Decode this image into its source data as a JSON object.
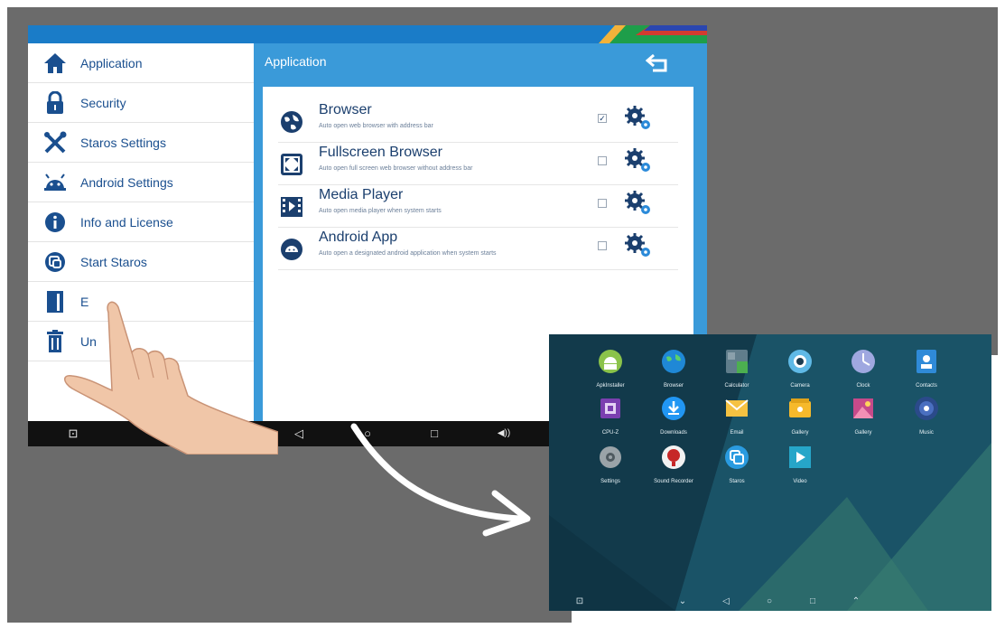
{
  "tablet": {
    "sidebar": {
      "items": [
        {
          "label": "Application",
          "icon": "home-icon"
        },
        {
          "label": "Security",
          "icon": "lock-icon"
        },
        {
          "label": "Staros Settings",
          "icon": "tools-icon"
        },
        {
          "label": "Android Settings",
          "icon": "android-icon"
        },
        {
          "label": "Info and License",
          "icon": "info-icon"
        },
        {
          "label": "Start Staros",
          "icon": "staros-icon"
        },
        {
          "label": "E",
          "icon": "exit-door-icon"
        },
        {
          "label": "Un",
          "icon": "trash-icon"
        }
      ]
    },
    "header": {
      "title": "Application",
      "back_icon": "back-arrow-icon"
    },
    "apps": [
      {
        "name": "Browser",
        "desc": "Auto open web browser with address bar",
        "checked": true,
        "icon": "globe-icon"
      },
      {
        "name": "Fullscreen Browser",
        "desc": "Auto open full screen web browser without address bar",
        "checked": false,
        "icon": "fullscreen-icon"
      },
      {
        "name": "Media Player",
        "desc": "Auto open media player when system starts",
        "checked": false,
        "icon": "film-icon"
      },
      {
        "name": "Android App",
        "desc": "Auto open a designated android application when system starts",
        "checked": false,
        "icon": "android-head-icon"
      }
    ],
    "checkmark": "✓",
    "nav": [
      {
        "glyph": "⊡",
        "name": "screenshot-icon"
      },
      {
        "glyph": "◁",
        "name": "back-icon"
      },
      {
        "glyph": "○",
        "name": "home-circle-icon"
      },
      {
        "glyph": "□",
        "name": "recents-icon"
      },
      {
        "glyph": "◀))",
        "name": "volume-icon"
      }
    ],
    "colors": {
      "accent": "#3a9ad9",
      "status_bar": "#1a7cc8",
      "text": "#1a4f8f",
      "nav": "#111111"
    }
  },
  "launcher": {
    "apps": [
      {
        "label": "ApkInstaller",
        "icon": "apk-installer-icon",
        "color": "#8bc34a"
      },
      {
        "label": "Browser",
        "icon": "browser-globe-icon",
        "color": "#1f88d6"
      },
      {
        "label": "Calculator",
        "icon": "calculator-icon",
        "color": "#607d8b"
      },
      {
        "label": "Camera",
        "icon": "camera-icon",
        "color": "#5fb9e6"
      },
      {
        "label": "Clock",
        "icon": "clock-icon",
        "color": "#9fa8e0"
      },
      {
        "label": "Contacts",
        "icon": "contacts-icon",
        "color": "#2f8ad8"
      },
      {
        "label": "CPU-Z",
        "icon": "cpu-icon",
        "color": "#7b3fb0"
      },
      {
        "label": "Downloads",
        "icon": "download-icon",
        "color": "#2196f3"
      },
      {
        "label": "Email",
        "icon": "email-icon",
        "color": "#f5c242"
      },
      {
        "label": "Gallery",
        "icon": "gallery-icon",
        "color": "#f6b92b"
      },
      {
        "label": "Gallery",
        "icon": "photo-icon",
        "color": "#c64a8a"
      },
      {
        "label": "Music",
        "icon": "music-icon",
        "color": "#2b4a8a"
      },
      {
        "label": "Settings",
        "icon": "settings-gear-icon",
        "color": "#9aa3a8"
      },
      {
        "label": "Sound Recorder",
        "icon": "sound-recorder-icon",
        "color": "#c62828"
      },
      {
        "label": "Staros",
        "icon": "staros-app-icon",
        "color": "#2a9be0"
      },
      {
        "label": "Video",
        "icon": "video-icon",
        "color": "#26a6c9"
      }
    ],
    "nav": [
      {
        "glyph": "⊡",
        "name": "launcher-screenshot-icon"
      },
      {
        "glyph": "⌄",
        "name": "launcher-volume-down-icon"
      },
      {
        "glyph": "◁",
        "name": "launcher-back-icon"
      },
      {
        "glyph": "○",
        "name": "launcher-home-icon"
      },
      {
        "glyph": "□",
        "name": "launcher-recents-icon"
      },
      {
        "glyph": "⌃",
        "name": "launcher-volume-up-icon"
      }
    ]
  }
}
